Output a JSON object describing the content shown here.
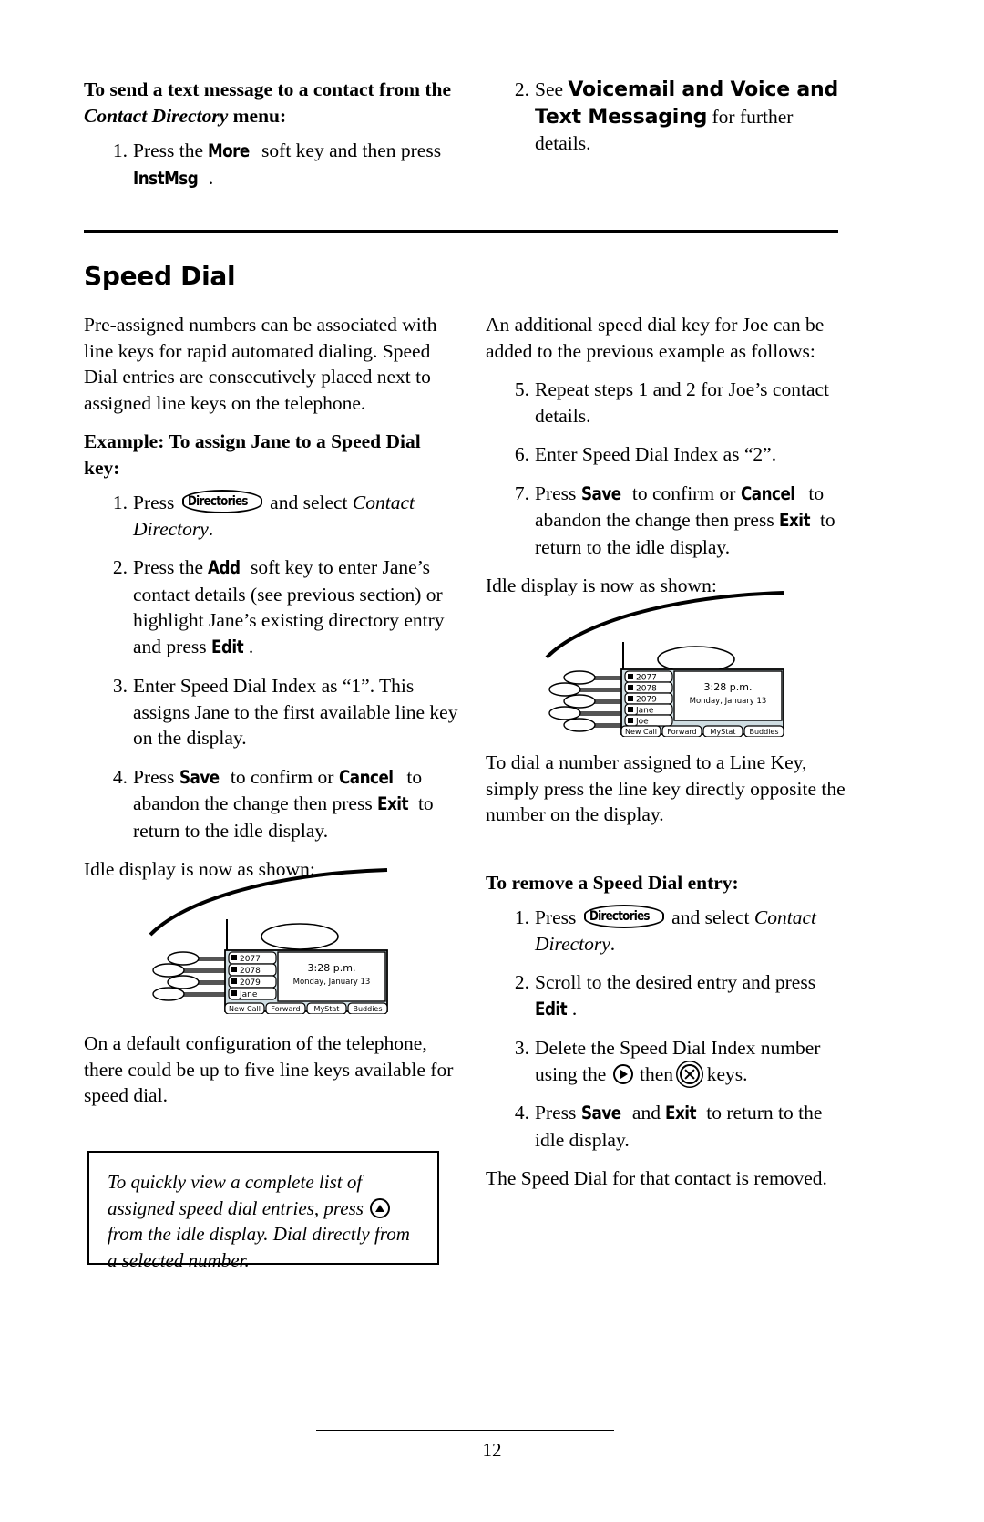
{
  "page": {
    "number": "12"
  },
  "left_column": {
    "intro_heading": {
      "part1": "To send a text message to a contact from the ",
      "italic": "Contact Directory",
      "part2": " menu:"
    },
    "intro_steps": [
      {
        "num": "1.",
        "pre": "Press the ",
        "key1": "More",
        "mid": " soft key and then press ",
        "key2": "InstMsg",
        "post": "."
      }
    ],
    "section_title": "Speed Dial",
    "body_paragraph": "Pre-assigned numbers can be associated with line keys for rapid automated dialing. Speed Dial entries are consecutively placed next to assigned line keys on the telephone.",
    "example_heading": {
      "text": "Example: To assign Jane to a Speed Dial key:"
    },
    "example_steps": [
      {
        "num": "1.",
        "pre": "Press ",
        "hardkey": "Directories",
        "mid": " and select ",
        "italic": "Contact Directory",
        "post": "."
      },
      {
        "num": "2.",
        "pre": "Press the ",
        "key1": "Add",
        "mid": " soft key to enter Jane’s contact details (see previous section) or highlight Jane’s existing directory entry and press ",
        "key2": "Edit",
        "post": "."
      },
      {
        "num": "3.",
        "text": "Enter Speed Dial Index as “1”.  This assigns Jane to the first available line key on the display."
      },
      {
        "num": "4.",
        "pre": "Press ",
        "key1": "Save",
        "mid": " to confirm or ",
        "key2": "Cancel",
        "mid2": " to abandon the change then press ",
        "key3": "Exit",
        "post": " to return to the idle display."
      }
    ],
    "idle_caption": "Idle display is now as shown:",
    "after_image_paragraph": "On a default configuration of the telephone, there could be up to five line keys available for speed dial.",
    "note": {
      "part1": "To quickly view a complete list of assigned speed dial entries, press ",
      "icon": "up-arrow-key-icon",
      "part2": " from the idle display.  Dial directly from a selected number."
    }
  },
  "right_column": {
    "intro_steps": [
      {
        "num": "2.",
        "pre": "See ",
        "bold": "Voicemail and Voice and Text Messaging",
        "post": " for further details."
      }
    ],
    "additional_paragraph": "An additional speed dial key for Joe can be added to the previous example as follows:",
    "additional_steps": [
      {
        "num": "5.",
        "text": "Repeat steps 1 and 2 for Joe’s contact details."
      },
      {
        "num": "6.",
        "text": "Enter Speed Dial Index as “2”."
      },
      {
        "num": "7.",
        "pre": "Press ",
        "key1": "Save",
        "mid": " to confirm or ",
        "key2": "Cancel",
        "mid2": " to abandon the change then press ",
        "key3": "Exit",
        "post": " to return to the idle display."
      }
    ],
    "idle_caption": "Idle display is now as shown:",
    "dial_paragraph": "To dial a number assigned to a Line Key, simply press the line key directly opposite the number on the display.",
    "remove_heading": "To remove a Speed Dial entry:",
    "remove_steps": [
      {
        "num": "1.",
        "pre": "Press ",
        "hardkey": "Directories",
        "mid": " and select ",
        "italic": "Contact Directory",
        "post": "."
      },
      {
        "num": "2.",
        "pre": "Scroll to the desired entry and press ",
        "key1": "Edit",
        "post": "."
      },
      {
        "num": "3.",
        "pre": "Delete the Speed Dial Index number using the ",
        "icon1": "right-arrow-key-icon",
        "mid": " then ",
        "icon2": "delete-x-key-icon",
        "post": " keys."
      },
      {
        "num": "4.",
        "pre": "Press ",
        "key1": "Save",
        "mid": " and ",
        "key2": "Exit",
        "post": " to return to the idle display."
      }
    ],
    "removed_paragraph": "The Speed Dial for that contact is removed."
  },
  "phone_illustration_left": {
    "lines": [
      "2077",
      "2078",
      "2079",
      "Jane"
    ],
    "time": "3:28 p.m.",
    "date": "Monday, January 13",
    "softkeys": [
      "New Call",
      "Forward",
      "MyStat",
      "Buddies"
    ]
  },
  "phone_illustration_right": {
    "lines": [
      "2077",
      "2078",
      "2079",
      "Jane",
      "Joe"
    ],
    "time": "3:28 p.m.",
    "date": "Monday, January 13",
    "softkeys": [
      "New Call",
      "Forward",
      "MyStat",
      "Buddies"
    ]
  },
  "colors": {
    "ink": "#000000",
    "paper": "#ffffff",
    "lcd_fill": "#cfdde2",
    "shadow": "#a8a8a8"
  }
}
